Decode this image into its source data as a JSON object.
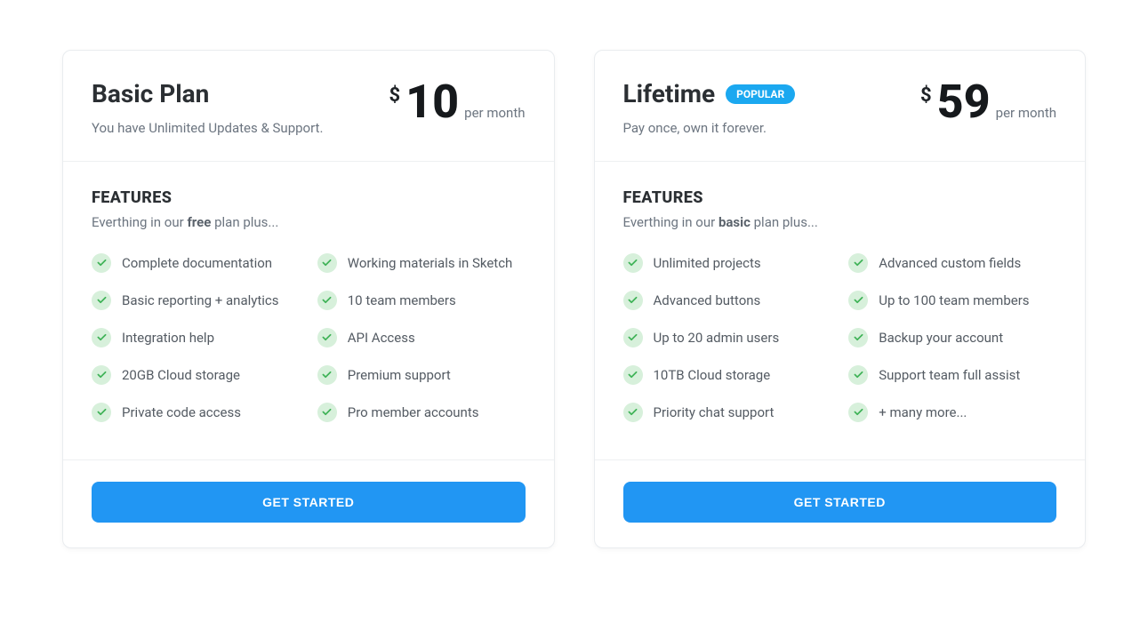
{
  "plans": [
    {
      "title": "Basic Plan",
      "subtitle": "You have Unlimited Updates & Support.",
      "badge": null,
      "currency": "$",
      "price": "10",
      "period": "per month",
      "features_heading": "FEATURES",
      "features_sub_prefix": "Everthing in our ",
      "features_sub_bold": "free",
      "features_sub_suffix": " plan plus...",
      "col1": [
        "Complete documentation",
        "Basic reporting + analytics",
        "Integration help",
        "20GB Cloud storage",
        "Private code access"
      ],
      "col2": [
        "Working materials in Sketch",
        "10 team members",
        "API Access",
        "Premium support",
        "Pro member accounts"
      ],
      "cta": "GET STARTED"
    },
    {
      "title": "Lifetime",
      "subtitle": "Pay once, own it forever.",
      "badge": "POPULAR",
      "currency": "$",
      "price": "59",
      "period": "per month",
      "features_heading": "FEATURES",
      "features_sub_prefix": "Everthing in our ",
      "features_sub_bold": "basic",
      "features_sub_suffix": " plan plus...",
      "col1": [
        "Unlimited projects",
        "Advanced buttons",
        "Up to 20 admin users",
        "10TB Cloud storage",
        "Priority chat support"
      ],
      "col2": [
        "Advanced custom fields",
        "Up to 100 team members",
        "Backup your account",
        "Support team full assist",
        "+ many more..."
      ],
      "cta": "GET STARTED"
    }
  ],
  "colors": {
    "accent": "#2196f3",
    "badge": "#1ba8f0",
    "check_bg": "#d7f0db",
    "check_fg": "#3eb256"
  }
}
